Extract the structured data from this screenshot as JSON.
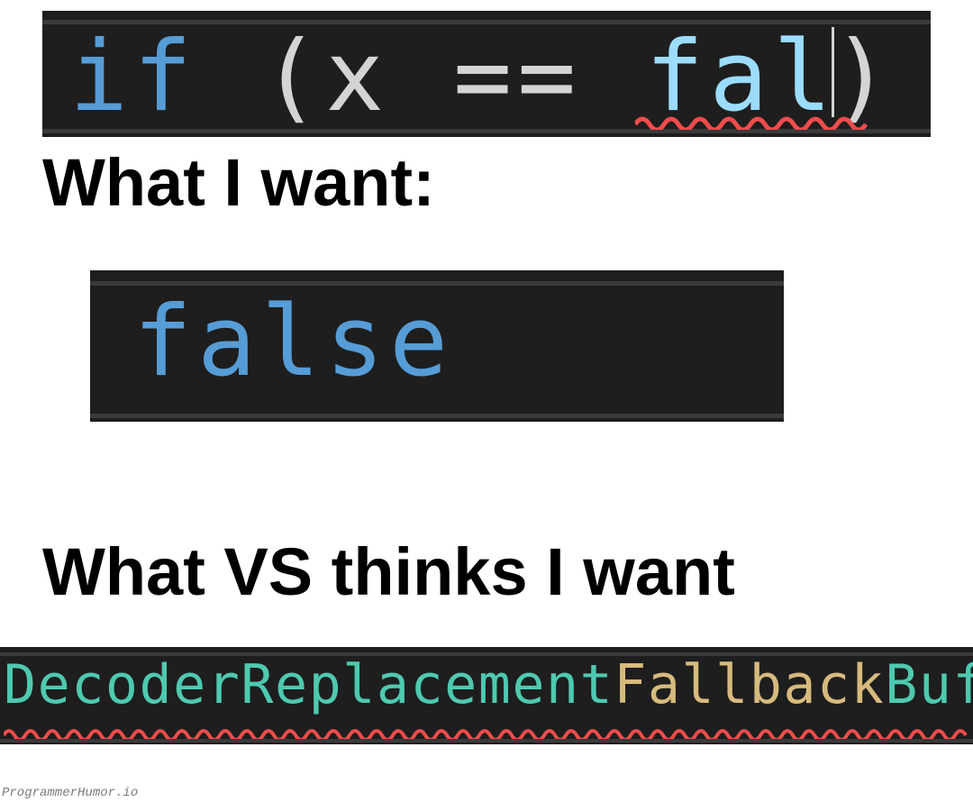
{
  "box1": {
    "kw": "if",
    "open": "(",
    "var": "x",
    "eq": "==",
    "partial": "fal",
    "close": ")"
  },
  "heading1": "What I want:",
  "box2": {
    "value": "false"
  },
  "heading2": "What  VS thinks I want",
  "box3": {
    "part1": "Decoder",
    "part2": "Replacement",
    "part3": "Fallback",
    "part4": "Buffer"
  },
  "watermark": "ProgrammerHumor.io"
}
